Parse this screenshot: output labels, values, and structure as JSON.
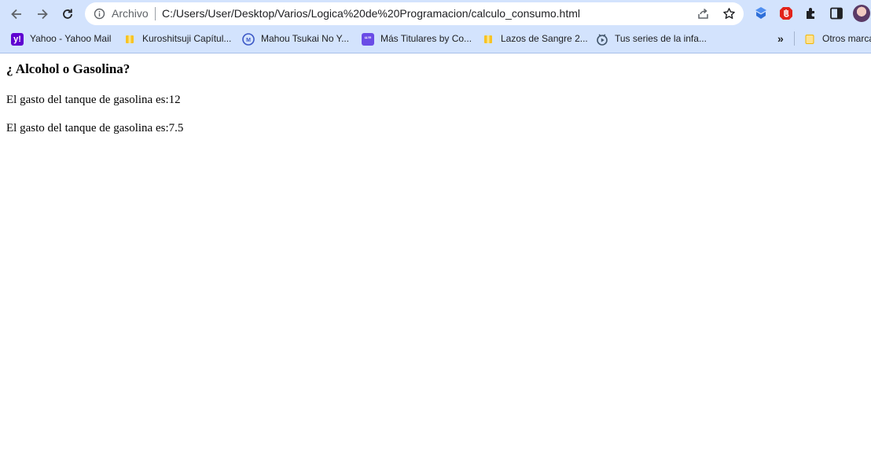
{
  "browser": {
    "scheme_label": "Archivo",
    "url": "C:/Users/User/Desktop/Varios/Logica%20de%20Programacion/calculo_consumo.html",
    "accent_color": "#d3e3fd"
  },
  "bookmarks": {
    "items": [
      {
        "label": "Yahoo - Yahoo Mail",
        "icon": "yahoo-icon"
      },
      {
        "label": "Kuroshitsuji Capítul...",
        "icon": "bookmark-folder-icon"
      },
      {
        "label": "Mahou Tsukai No Y...",
        "icon": "manga-icon"
      },
      {
        "label": "Más Titulares by Co...",
        "icon": "quote-icon"
      },
      {
        "label": "Lazos de Sangre 2...",
        "icon": "bookmark-folder-icon"
      },
      {
        "label": "Tus series de la infa...",
        "icon": "play-icon"
      }
    ],
    "overflow_label": "»",
    "other_label": "Otros marca"
  },
  "page": {
    "title": "¿ Alcohol o Gasolina?",
    "line1_prefix": "El gasto del tanque de gasolina es:",
    "line1_value": "12",
    "line2_prefix": "El gasto del tanque de gasolina es:",
    "line2_value": "7.5"
  }
}
